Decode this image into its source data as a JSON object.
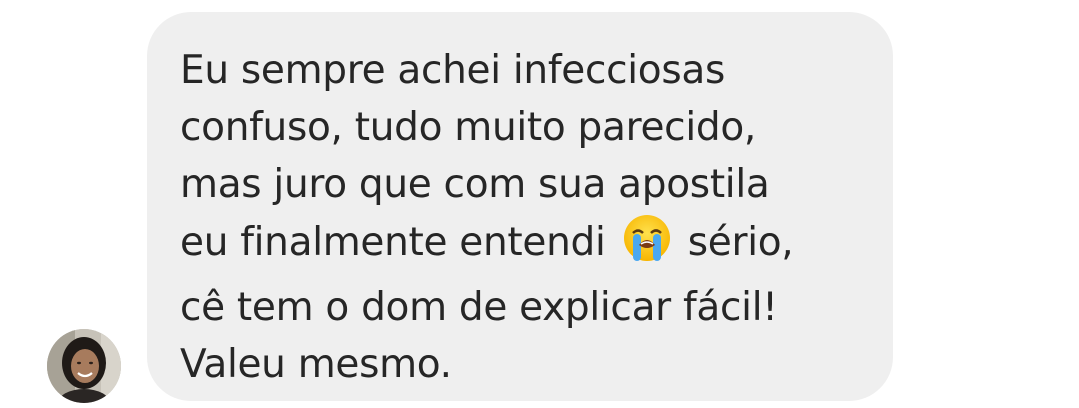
{
  "conversation": {
    "avatar_icon": "user-avatar-icon",
    "message": {
      "line1": "Eu sempre achei infecciosas",
      "line2": "confuso, tudo muito parecido,",
      "line3": "mas juro que com sua apostila",
      "line4_before_emoji": "eu finalmente entendi",
      "emoji_icon": "loudly-crying-face-icon",
      "line4_after_emoji": "sério,",
      "line5": "cê tem o dom de explicar fácil!",
      "line6": "Valeu mesmo."
    }
  },
  "colors": {
    "bubble_bg": "#efefef",
    "text": "#262626",
    "page_bg": "#ffffff"
  }
}
